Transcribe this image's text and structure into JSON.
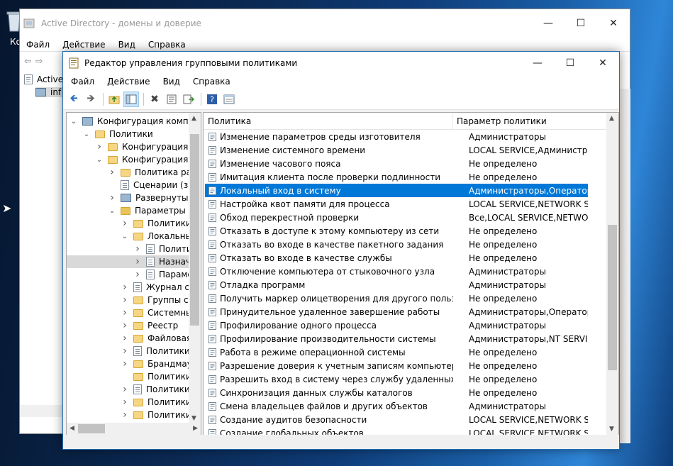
{
  "desktop": {
    "icon_label": "Ко"
  },
  "back_window": {
    "title": "Active Directory - домены и доверие",
    "menu": [
      "Файл",
      "Действие",
      "Вид",
      "Справка"
    ],
    "tree_items": [
      "Active",
      "inf"
    ]
  },
  "window": {
    "title": "Редактор управления групповыми политиками",
    "menu": [
      "Файл",
      "Действие",
      "Вид",
      "Справка"
    ],
    "controls": {
      "minimize": "—",
      "maximize": "☐",
      "close": "✕"
    }
  },
  "tree": [
    {
      "label": "Конфигурация компьютера",
      "icon": "computer-icon",
      "chev": "down"
    },
    {
      "label": "Политики",
      "icon": "folder-icon",
      "chev": "down"
    },
    {
      "label": "Конфигурация программ",
      "icon": "folder-icon",
      "chev": "right"
    },
    {
      "label": "Конфигурация Windows",
      "icon": "folder-icon",
      "chev": "down"
    },
    {
      "label": "Политика разрешения имен",
      "icon": "folder-icon",
      "chev": "right"
    },
    {
      "label": "Сценарии (запуск/завершение)",
      "icon": "doc-icon",
      "chev": ""
    },
    {
      "label": "Развернутые принтеры",
      "icon": "printer-icon",
      "chev": "right"
    },
    {
      "label": "Параметры безопасности",
      "icon": "security-icon",
      "chev": "down"
    },
    {
      "label": "Политики учетных записей",
      "icon": "folder-icon",
      "chev": "right"
    },
    {
      "label": "Локальные политики",
      "icon": "folder-icon",
      "chev": "down"
    },
    {
      "label": "Политика аудита",
      "icon": "doc-icon",
      "chev": "right"
    },
    {
      "label": "Назначение прав пользователя",
      "icon": "doc-icon",
      "chev": "right",
      "selected": true
    },
    {
      "label": "Параметры безопасности",
      "icon": "doc-icon",
      "chev": "right"
    },
    {
      "label": "Журнал событий",
      "icon": "doc-icon",
      "chev": "right"
    },
    {
      "label": "Группы с ограниченным доступом",
      "icon": "folder-icon",
      "chev": "right"
    },
    {
      "label": "Системные службы",
      "icon": "folder-icon",
      "chev": "right"
    },
    {
      "label": "Реестр",
      "icon": "folder-icon",
      "chev": "right"
    },
    {
      "label": "Файловая система",
      "icon": "folder-icon",
      "chev": "right"
    },
    {
      "label": "Политики проводной сети",
      "icon": "doc-icon",
      "chev": "right"
    },
    {
      "label": "Брандмауэр Защитника Windows",
      "icon": "folder-icon",
      "chev": "right"
    },
    {
      "label": "Политики диспетчера списка сетей",
      "icon": "folder-icon",
      "chev": ""
    },
    {
      "label": "Политики беспроводной сети",
      "icon": "doc-icon",
      "chev": "right"
    },
    {
      "label": "Политики открытого ключа",
      "icon": "folder-icon",
      "chev": "right"
    },
    {
      "label": "Политики ограниченного использования программ",
      "icon": "folder-icon",
      "chev": "right"
    }
  ],
  "list": {
    "headers": [
      "Политика",
      "Параметр политики"
    ],
    "rows": [
      [
        "Изменение параметров среды изготовителя",
        "Администраторы"
      ],
      [
        "Изменение системного времени",
        "LOCAL SERVICE,Администрато..."
      ],
      [
        "Изменение часового пояса",
        "Не определено"
      ],
      [
        "Имитация клиента после проверки подлинности",
        "Не определено"
      ],
      [
        "Локальный вход в систему",
        "Администраторы,Операторы ..."
      ],
      [
        "Настройка квот памяти для процесса",
        "LOCAL SERVICE,NETWORK SER..."
      ],
      [
        "Обход перекрестной проверки",
        "Все,LOCAL SERVICE,NETWORK ..."
      ],
      [
        "Отказать в доступе к этому компьютеру из сети",
        "Не определено"
      ],
      [
        "Отказать во входе в качестве пакетного задания",
        "Не определено"
      ],
      [
        "Отказать во входе в качестве службы",
        "Не определено"
      ],
      [
        "Отключение компьютера от стыковочного узла",
        "Администраторы"
      ],
      [
        "Отладка программ",
        "Администраторы"
      ],
      [
        "Получить маркер олицетворения для другого пользоват...",
        "Не определено"
      ],
      [
        "Принудительное удаленное завершение работы",
        "Администраторы,Операторы ..."
      ],
      [
        "Профилирование одного процесса",
        "Администраторы"
      ],
      [
        "Профилирование производительности системы",
        "Администраторы,NT SERVICE\\..."
      ],
      [
        "Работа в режиме операционной системы",
        "Не определено"
      ],
      [
        "Разрешение доверия к учетным записям компьютеров и...",
        "Не определено"
      ],
      [
        "Разрешить вход в систему через службу удаленных рабо...",
        "Не определено"
      ],
      [
        "Синхронизация данных службы каталогов",
        "Не определено"
      ],
      [
        "Смена владельцев файлов и других объектов",
        "Администраторы"
      ],
      [
        "Создание аудитов безопасности",
        "LOCAL SERVICE,NETWORK SER..."
      ],
      [
        "Создание глобальных объектов",
        "LOCAL SERVICE,NETWORK SER..."
      ]
    ],
    "selected_index": 4
  },
  "colors": {
    "selection": "#0078d7",
    "accent": "#1f6fb8"
  }
}
